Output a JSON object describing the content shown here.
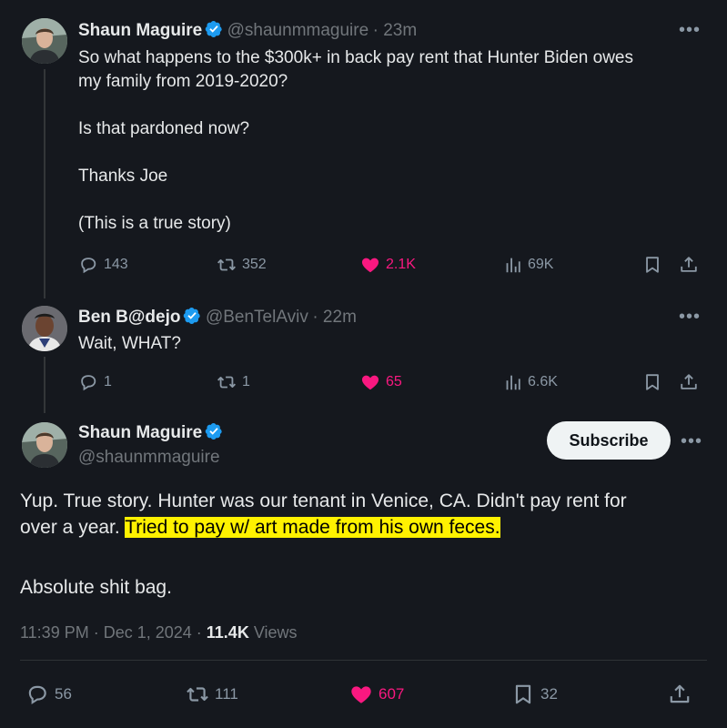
{
  "tweet1": {
    "name": "Shaun Maguire",
    "handle": "@shaunmmaguire",
    "time": "· 23m",
    "text": "So what happens to the $300k+ in back pay rent that Hunter Biden owes\nmy family from 2019-2020?\n\nIs that pardoned now?\n\nThanks Joe\n\n(This is a true story)",
    "replies": "143",
    "reposts": "352",
    "likes": "2.1K",
    "views": "69K"
  },
  "tweet2": {
    "name": "Ben B@dejo",
    "handle": "@BenTelAviv",
    "time": "· 22m",
    "text": "Wait, WHAT?",
    "replies": "1",
    "reposts": "1",
    "likes": "65",
    "views": "6.6K"
  },
  "main": {
    "name": "Shaun Maguire",
    "handle": "@shaunmmaguire",
    "subscribe_label": "Subscribe",
    "text_line1": "Yup. True story. Hunter was our tenant in Venice, CA. Didn't pay rent for",
    "text_line2_plain": "over a year. ",
    "text_line2_highlight": "Tried to pay w/ art made from his own feces.",
    "text_line3": "Absolute shit bag.",
    "timestamp": "11:39 PM · Dec 1, 2024 · ",
    "views_count": "11.4K",
    "views_label": " Views",
    "replies": "56",
    "reposts": "111",
    "likes": "607",
    "bookmarks": "32"
  },
  "colors": {
    "background": "#15181e",
    "verified": "#1d9bf0",
    "like": "#f91880",
    "highlight": "#fff200"
  },
  "icons": {
    "reply": "speech-bubble",
    "repost": "repost-arrows",
    "like": "heart",
    "views": "bar-chart",
    "bookmark": "bookmark",
    "share": "upload-arrow",
    "more": "ellipsis"
  }
}
